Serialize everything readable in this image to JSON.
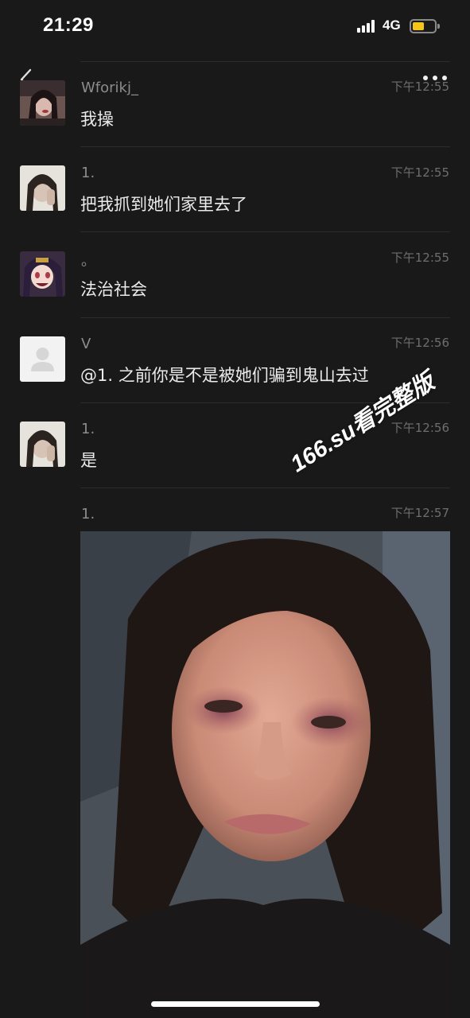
{
  "status_bar": {
    "time": "21:29",
    "network": "4G",
    "battery_color": "#f2c811"
  },
  "nav": {
    "back_icon": "chevron-left-icon",
    "more_icon": "ellipsis-icon"
  },
  "comments": [
    {
      "username": "Wforikj_",
      "time": "下午12:55",
      "text": "我操",
      "avatar": "girl-photo-avatar"
    },
    {
      "username": "1.",
      "time": "下午12:55",
      "text": "把我抓到她们家里去了",
      "avatar": "girl-photo-avatar"
    },
    {
      "username": "。",
      "time": "下午12:55",
      "text": "法治社会",
      "avatar": "anime-avatar"
    },
    {
      "username": "V",
      "time": "下午12:56",
      "text": "@1. 之前你是不是被她们骗到鬼山去过",
      "avatar": "default-avatar"
    },
    {
      "username": "1.",
      "time": "下午12:56",
      "text": "是",
      "avatar": "girl-photo-avatar"
    },
    {
      "username": "1.",
      "time": "下午12:57",
      "text": "",
      "avatar": "none",
      "attachment": "photo-of-injured-face"
    }
  ],
  "watermark": "166.su看完整版",
  "colors": {
    "background": "#191919",
    "divider": "#2c2c2c",
    "username": "#8c8c8c",
    "timestamp": "#6e6e6e",
    "message": "#ebebeb"
  }
}
